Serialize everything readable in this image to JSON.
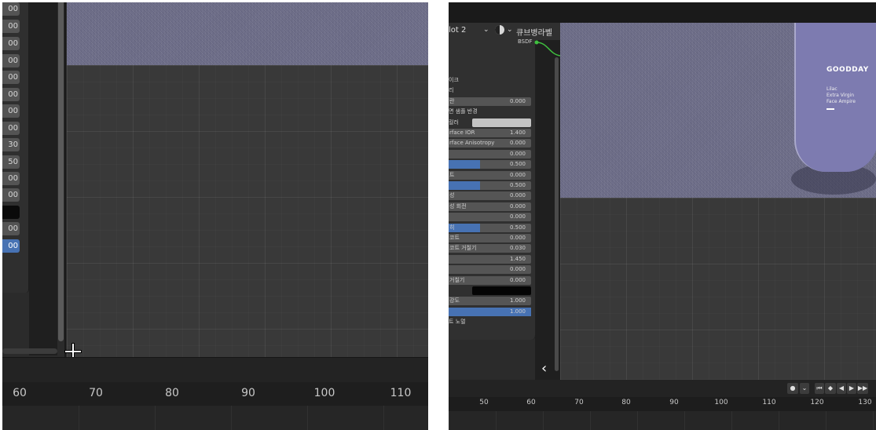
{
  "left_panel": {
    "field_values": [
      "00",
      "00",
      "00",
      "00",
      "00",
      "00",
      "00",
      "00",
      "30",
      "50",
      "00",
      "00",
      "",
      "00",
      "00"
    ],
    "timeline_ticks": [
      "60",
      "70",
      "80",
      "90",
      "100",
      "110"
    ]
  },
  "right_panel": {
    "header": {
      "slot_label": "lot 2",
      "material_name": "큐브병라벨"
    },
    "bsdf_label": "BSDF",
    "node_rows": [
      {
        "label": "이크",
        "value": "",
        "type": "text"
      },
      {
        "label": "리",
        "value": "",
        "type": "text"
      },
      {
        "label": "란",
        "value": "0.000",
        "type": "field"
      },
      {
        "label": "면 샘플 반경",
        "value": "",
        "type": "text"
      },
      {
        "label": "컬러",
        "value": "",
        "type": "swatch-light"
      },
      {
        "label": "rface IOR",
        "value": "1.400",
        "type": "field"
      },
      {
        "label": "rface Anisotropy",
        "value": "0.000",
        "type": "field"
      },
      {
        "label": "",
        "value": "0.000",
        "type": "field"
      },
      {
        "label": "",
        "value": "0.500",
        "type": "slider",
        "fill": 0.5
      },
      {
        "label": "트",
        "value": "0.000",
        "type": "field"
      },
      {
        "label": "",
        "value": "0.500",
        "type": "slider",
        "fill": 0.5
      },
      {
        "label": "성",
        "value": "0.000",
        "type": "field"
      },
      {
        "label": "성 회전",
        "value": "0.000",
        "type": "field"
      },
      {
        "label": "",
        "value": "0.000",
        "type": "field"
      },
      {
        "label": "히",
        "value": "0.500",
        "type": "slider",
        "fill": 0.5
      },
      {
        "label": "코트",
        "value": "0.000",
        "type": "field"
      },
      {
        "label": "코트 거칠기",
        "value": "0.030",
        "type": "field"
      },
      {
        "label": "",
        "value": "1.450",
        "type": "field"
      },
      {
        "label": "",
        "value": "0.000",
        "type": "field"
      },
      {
        "label": "거칠기",
        "value": "0.000",
        "type": "field"
      },
      {
        "label": "",
        "value": "",
        "type": "swatch-dark"
      },
      {
        "label": "강도",
        "value": "1.000",
        "type": "field"
      },
      {
        "label": "",
        "value": "1.000",
        "type": "slider",
        "fill": 1.0
      }
    ],
    "node_footer": "트 노멀",
    "product": {
      "brand": "GOODDAY",
      "line1": "Lilac",
      "line2": "Extra Virgin",
      "line3": "Face Ampire"
    },
    "timeline_ticks": [
      "50",
      "60",
      "70",
      "80",
      "90",
      "100",
      "110",
      "120",
      "130"
    ],
    "chevron": "‹"
  },
  "colors": {
    "accent_blue": "#4772b3",
    "render_lilac": "#6e6e8a",
    "link_green": "#3fbf3f"
  }
}
